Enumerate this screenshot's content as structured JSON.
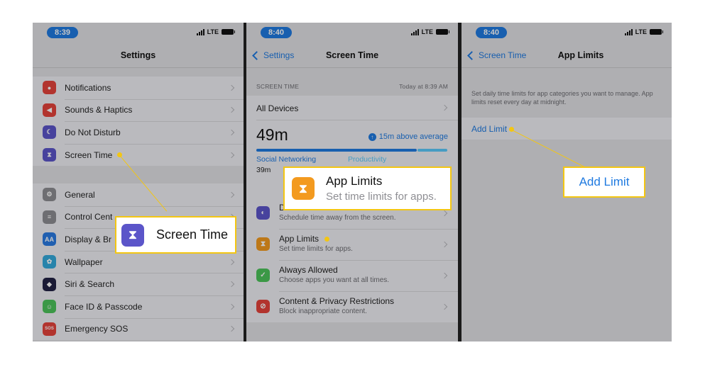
{
  "panel1": {
    "time": "8:39",
    "network": "LTE",
    "title": "Settings",
    "group1": [
      {
        "label": "Notifications",
        "icon": "notifications-icon",
        "color": "#e5433c",
        "glyph": "●"
      },
      {
        "label": "Sounds & Haptics",
        "icon": "speaker-icon",
        "color": "#e5433c",
        "glyph": "◀"
      },
      {
        "label": "Do Not Disturb",
        "icon": "moon-icon",
        "color": "#5b55c9",
        "glyph": "☾"
      },
      {
        "label": "Screen Time",
        "icon": "hourglass-icon",
        "color": "#5b55c9",
        "glyph": "⧗"
      }
    ],
    "group2": [
      {
        "label": "General",
        "icon": "gear-icon",
        "color": "#8e8e93",
        "glyph": "⚙"
      },
      {
        "label": "Control Cent",
        "icon": "toggles-icon",
        "color": "#8e8e93",
        "glyph": "≡"
      },
      {
        "label": "Display & Br",
        "icon": "text-size-icon",
        "color": "#2a7ae2",
        "glyph": "AA"
      },
      {
        "label": "Wallpaper",
        "icon": "flower-icon",
        "color": "#34aadc",
        "glyph": "✿"
      },
      {
        "label": "Siri & Search",
        "icon": "siri-icon",
        "color": "#222244",
        "glyph": "◆"
      },
      {
        "label": "Face ID & Passcode",
        "icon": "face-id-icon",
        "color": "#4cc35a",
        "glyph": "☺"
      },
      {
        "label": "Emergency SOS",
        "icon": "sos-icon",
        "color": "#e5433c",
        "glyph": "SOS"
      }
    ],
    "callout": {
      "label": "Screen Time",
      "icon": "hourglass-icon"
    }
  },
  "panel2": {
    "time": "8:40",
    "network": "LTE",
    "back_label": "Settings",
    "title": "Screen Time",
    "section_label": "SCREEN TIME",
    "today_label": "Today at 8:39 AM",
    "all_devices": "All Devices",
    "total_time": "49m",
    "average_note": "15m above average",
    "category1": "Social Networking",
    "category1_time": "39m",
    "category2": "Productivity",
    "rows": [
      {
        "title": "Downtime",
        "subtitle": "Schedule time away from the screen.",
        "icon": "downtime-icon",
        "color": "#5b55c9",
        "glyph": "◐"
      },
      {
        "title": "App Limits",
        "subtitle": "Set time limits for apps.",
        "icon": "hourglass-icon",
        "color": "#f39a1f",
        "glyph": "⧗"
      },
      {
        "title": "Always Allowed",
        "subtitle": "Choose apps you want at all times.",
        "icon": "checkmark-icon",
        "color": "#4cc35a",
        "glyph": "✓"
      },
      {
        "title": "Content & Privacy Restrictions",
        "subtitle": "Block inappropriate content.",
        "icon": "restriction-icon",
        "color": "#e5433c",
        "glyph": "⊘"
      }
    ],
    "callout": {
      "title": "App Limits",
      "subtitle": "Set time limits for apps.",
      "icon": "hourglass-icon"
    }
  },
  "panel3": {
    "time": "8:40",
    "network": "LTE",
    "back_label": "Screen Time",
    "title": "App Limits",
    "description": "Set daily time limits for app categories you want to manage. App limits reset every day at midnight.",
    "add_limit": "Add Limit",
    "callout": {
      "label": "Add Limit"
    }
  },
  "colors": {
    "accent": "#1f7ae0",
    "highlight": "#f3c613",
    "social_bar": "#1f7ae0",
    "productivity_bar": "#5ac8fa"
  }
}
